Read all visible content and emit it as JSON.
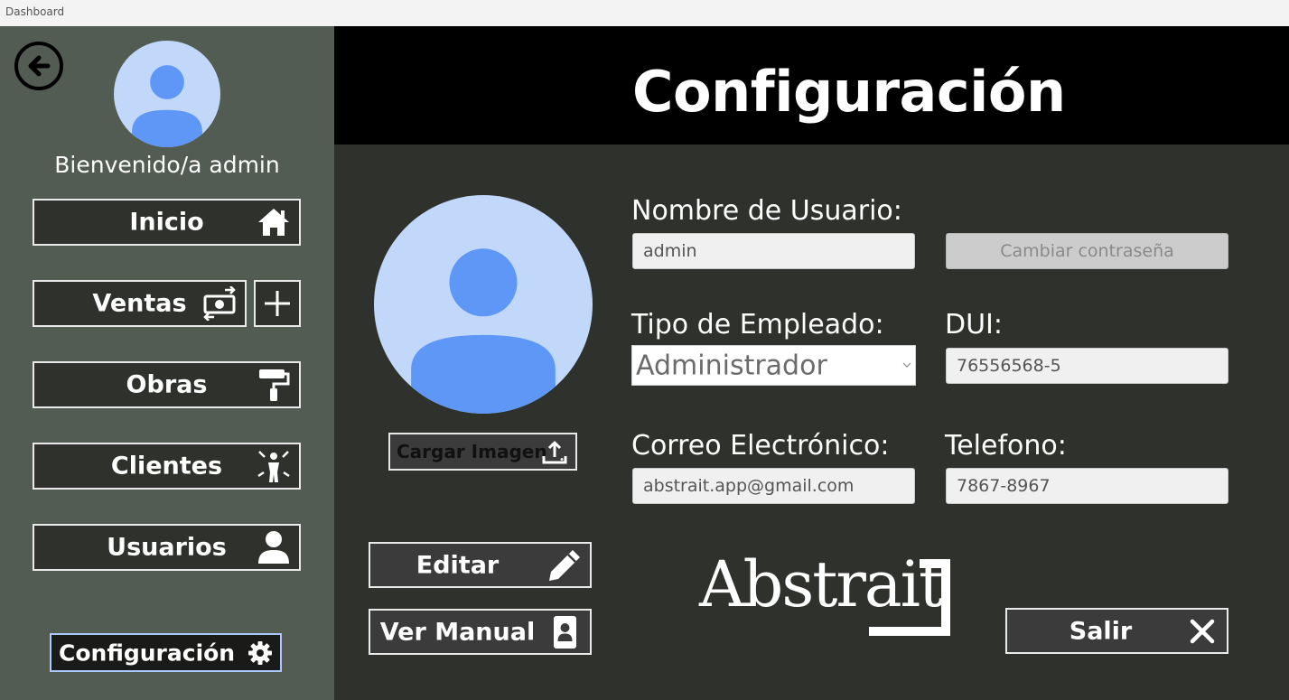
{
  "window": {
    "title": "Dashboard"
  },
  "sidebar": {
    "welcome": "Bienvenido/a admin",
    "items": [
      {
        "label": "Inicio",
        "icon": "home-icon"
      },
      {
        "label": "Ventas",
        "icon": "money-exchange-icon"
      },
      {
        "label": "Obras",
        "icon": "paint-roller-icon"
      },
      {
        "label": "Clientes",
        "icon": "person-rays-icon"
      },
      {
        "label": "Usuarios",
        "icon": "user-icon"
      }
    ],
    "config_label": "Configuración",
    "config_icon": "gear-icon"
  },
  "header": {
    "title": "Configuración"
  },
  "form": {
    "upload_label": "Cargar Imagen",
    "username_label": "Nombre de Usuario:",
    "username_value": "admin",
    "change_password_label": "Cambiar contraseña",
    "employee_type_label": "Tipo de Empleado:",
    "employee_type_value": "Administrador",
    "dui_label": "DUI:",
    "dui_value": "76556568-5",
    "email_label": "Correo Electrónico:",
    "email_value": "abstrait.app@gmail.com",
    "phone_label": "Telefono:",
    "phone_value": "7867-8967"
  },
  "actions": {
    "edit_label": "Editar",
    "manual_label": "Ver Manual",
    "exit_label": "Salir"
  },
  "brand": {
    "logo_text": "Abstrait"
  },
  "colors": {
    "sidebar_bg": "#525c52",
    "main_bg": "#2f312c",
    "header_bg": "#000000",
    "avatar_bg": "#c2d8fb",
    "avatar_fg": "#5e97f6",
    "config_border": "#a9c8ff"
  }
}
